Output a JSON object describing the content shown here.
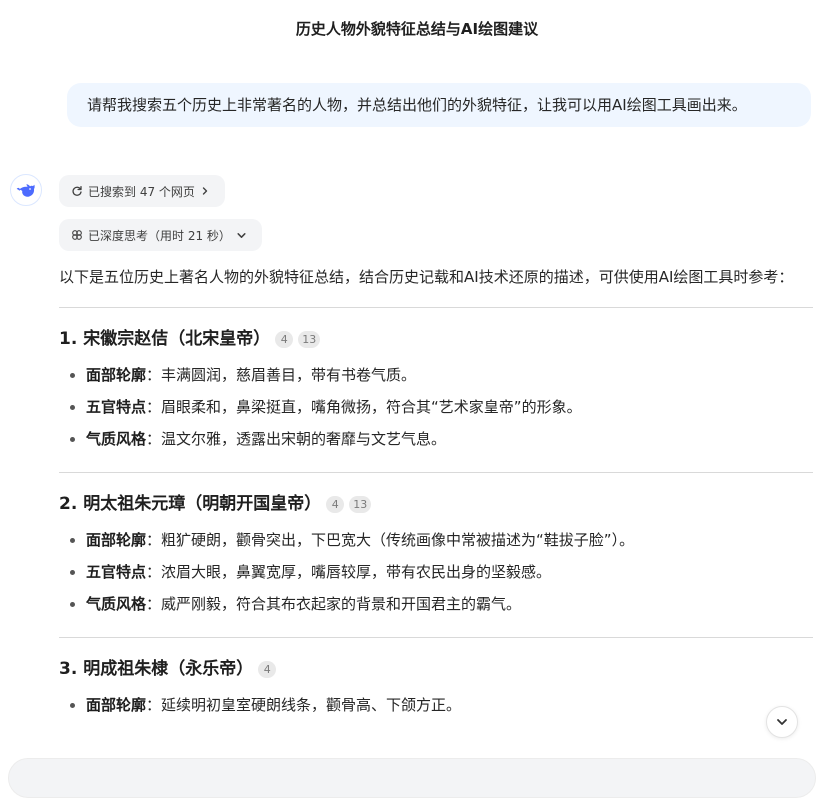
{
  "header": {
    "title": "历史人物外貌特征总结与AI绘图建议"
  },
  "user_message": {
    "text": "请帮我搜索五个历史上非常著名的人物，并总结出他们的外貌特征，让我可以用AI绘图工具画出来。"
  },
  "assistant": {
    "avatar_icon": "whale-logo-icon",
    "search_chip": {
      "label": "已搜索到 47 个网页",
      "icon": "search-refresh-icon",
      "chevron": "chevron-right-icon"
    },
    "think_chip": {
      "label": "已深度思考（用时 21 秒）",
      "icon": "deep-think-icon",
      "chevron": "chevron-down-icon"
    },
    "intro": "以下是五位历史上著名人物的外貌特征总结，结合历史记载和AI技术还原的描述，可供使用AI绘图工具时参考：",
    "sections": [
      {
        "title": "1. 宋徽宗赵佶（北宋皇帝）",
        "citations": [
          "4",
          "13"
        ],
        "bullets": [
          {
            "label": "面部轮廓",
            "sep": "：",
            "text": "丰满圆润，慈眉善目，带有书卷气质。"
          },
          {
            "label": "五官特点",
            "sep": "：",
            "text": "眉眼柔和，鼻梁挺直，嘴角微扬，符合其“艺术家皇帝”的形象。"
          },
          {
            "label": "气质风格",
            "sep": "：",
            "text": "温文尔雅，透露出宋朝的奢靡与文艺气息。"
          }
        ]
      },
      {
        "title": "2. 明太祖朱元璋（明朝开国皇帝）",
        "citations": [
          "4",
          "13"
        ],
        "bullets": [
          {
            "label": "面部轮廓",
            "sep": "：",
            "text": "粗犷硬朗，颧骨突出，下巴宽大（传统画像中常被描述为“鞋拔子脸”）。"
          },
          {
            "label": "五官特点",
            "sep": "：",
            "text": "浓眉大眼，鼻翼宽厚，嘴唇较厚，带有农民出身的坚毅感。"
          },
          {
            "label": "气质风格",
            "sep": "：",
            "text": "威严刚毅，符合其布衣起家的背景和开国君主的霸气。"
          }
        ]
      },
      {
        "title": "3. 明成祖朱棣（永乐帝）",
        "citations": [
          "4"
        ],
        "bullets": [
          {
            "label": "面部轮廓",
            "sep": "：",
            "text": "延续明初皇室硬朗线条，颧骨高、下颌方正。"
          }
        ]
      }
    ],
    "scroll_button_icon": "chevron-down-icon"
  },
  "colors": {
    "user_bubble_bg": "#eff6ff",
    "chip_bg": "#f3f4f6",
    "citation_bg": "#e9e9e9",
    "brand_blue": "#4d6bfe",
    "divider": "#d9d9d9"
  }
}
